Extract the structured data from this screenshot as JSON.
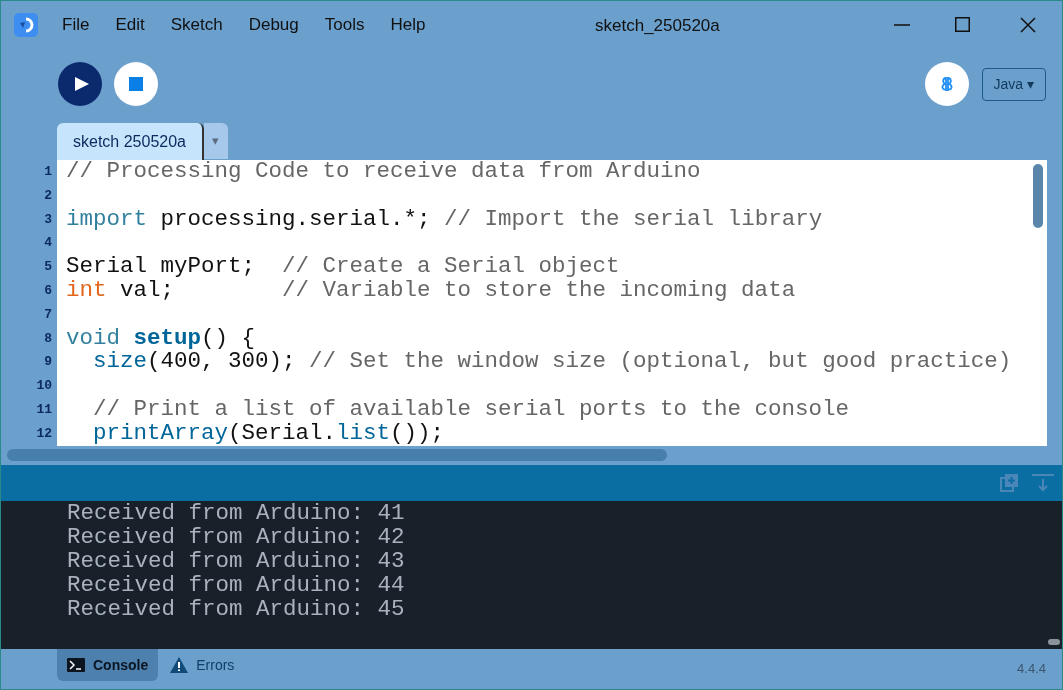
{
  "window": {
    "title": "sketch_250520a"
  },
  "menu": [
    "File",
    "Edit",
    "Sketch",
    "Debug",
    "Tools",
    "Help"
  ],
  "mode": {
    "label": "Java ▾"
  },
  "tabs": [
    {
      "label": "sketch 250520a",
      "selected": true
    }
  ],
  "tab_menu": "▾",
  "editor": {
    "lines": [
      {
        "number": "1",
        "tokens": [
          {
            "kind": "comment",
            "text": "// Processing Code to receive data from Arduino"
          }
        ]
      },
      {
        "number": "2"
      },
      {
        "number": "3",
        "tokens": [
          {
            "kind": "keyword",
            "text": "import"
          },
          {
            "kind": "plain",
            "text": " processing.serial.*; "
          },
          {
            "kind": "comment",
            "text": "// Import the serial library"
          }
        ]
      },
      {
        "number": "4"
      },
      {
        "number": "5",
        "tokens": [
          {
            "kind": "plain",
            "text": "Serial myPort;  "
          },
          {
            "kind": "comment",
            "text": "// Create a Serial object"
          }
        ]
      },
      {
        "number": "6",
        "tokens": [
          {
            "kind": "type",
            "text": "int"
          },
          {
            "kind": "plain",
            "text": " val;        "
          },
          {
            "kind": "comment",
            "text": "// Variable to store the incoming data"
          }
        ]
      },
      {
        "number": "7"
      },
      {
        "number": "8",
        "tokens": [
          {
            "kind": "keyword",
            "text": "void "
          },
          {
            "kind": "function",
            "text": "setup"
          },
          {
            "kind": "plain",
            "text": "() {"
          }
        ]
      },
      {
        "number": "9",
        "indented": true,
        "tokens": [
          {
            "kind": "call",
            "text": "size"
          },
          {
            "kind": "plain",
            "text": "(400, 300); "
          },
          {
            "kind": "comment",
            "text": "// Set the window size (optional, but good practice)"
          }
        ]
      },
      {
        "number": "10"
      },
      {
        "number": "11",
        "indented": true,
        "tokens": [
          {
            "kind": "comment",
            "text": "// Print a list of available serial ports to the console"
          }
        ]
      },
      {
        "number": "12",
        "indented": true,
        "tokens": [
          {
            "kind": "call",
            "text": "printArray"
          },
          {
            "kind": "plain",
            "text": "(Serial."
          },
          {
            "kind": "call",
            "text": "list"
          },
          {
            "kind": "plain",
            "text": "());"
          }
        ]
      }
    ]
  },
  "console": {
    "lines": [
      "Received from Arduino: 41",
      "Received from Arduino: 42",
      "Received from Arduino: 43",
      "Received from Arduino: 44",
      "Received from Arduino: 45"
    ]
  },
  "bottom_tabs": [
    {
      "label": "Console",
      "kind": "console",
      "selected": true
    },
    {
      "label": "Errors",
      "kind": "errors",
      "selected": false
    }
  ],
  "version": "4.4.4"
}
